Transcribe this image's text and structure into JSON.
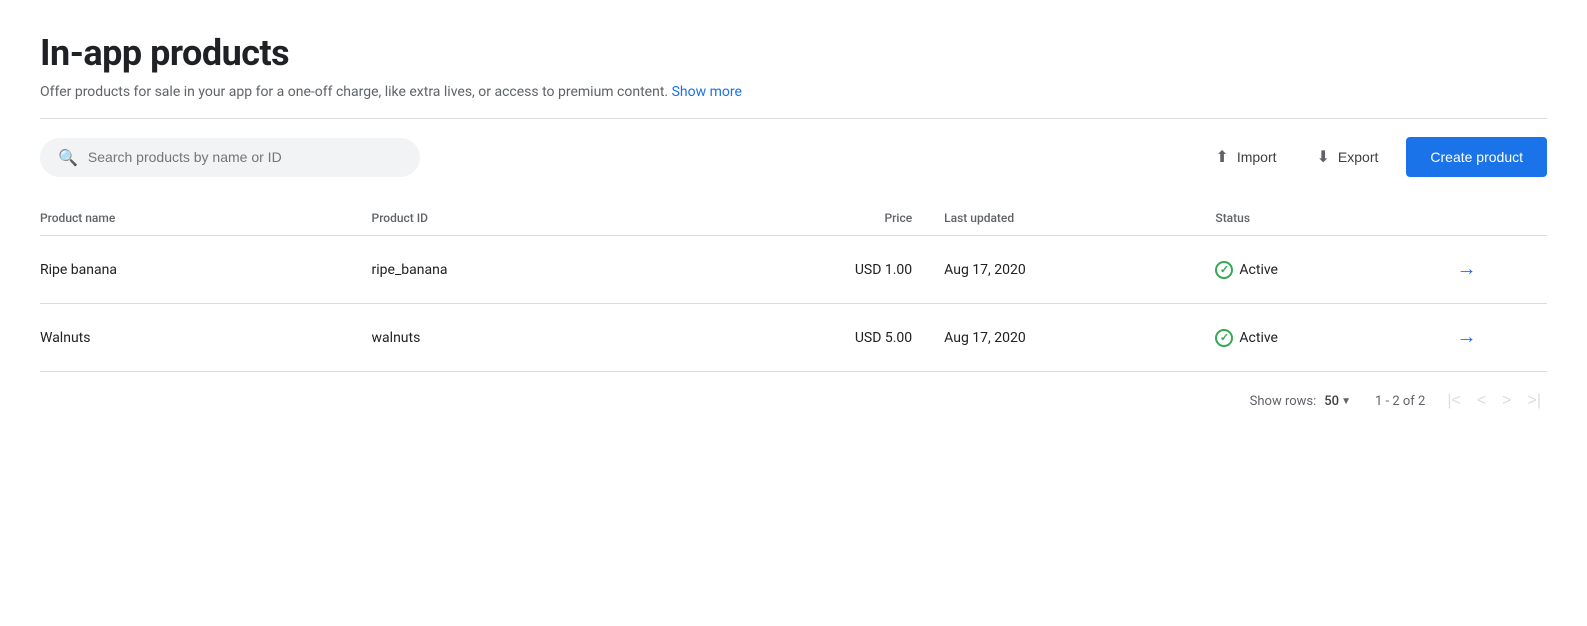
{
  "page": {
    "title": "In-app products",
    "subtitle": "Offer products for sale in your app for a one-off charge, like extra lives, or access to premium content.",
    "show_more_label": "Show more"
  },
  "toolbar": {
    "search_placeholder": "Search products by name or ID",
    "import_label": "Import",
    "export_label": "Export",
    "create_label": "Create product"
  },
  "table": {
    "columns": [
      {
        "key": "name",
        "label": "Product name"
      },
      {
        "key": "id",
        "label": "Product ID"
      },
      {
        "key": "price",
        "label": "Price"
      },
      {
        "key": "updated",
        "label": "Last updated"
      },
      {
        "key": "status",
        "label": "Status"
      }
    ],
    "rows": [
      {
        "name": "Ripe banana",
        "id": "ripe_banana",
        "price": "USD 1.00",
        "updated": "Aug 17, 2020",
        "status": "Active"
      },
      {
        "name": "Walnuts",
        "id": "walnuts",
        "price": "USD 5.00",
        "updated": "Aug 17, 2020",
        "status": "Active"
      }
    ]
  },
  "pagination": {
    "rows_label": "Show rows:",
    "rows_value": "50",
    "page_info": "1 - 2 of 2"
  }
}
